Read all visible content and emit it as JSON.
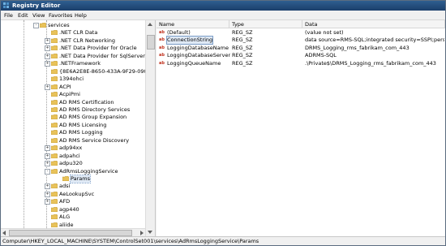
{
  "window": {
    "title": "Registry Editor"
  },
  "menubar": {
    "items": [
      "File",
      "Edit",
      "View",
      "Favorites",
      "Help"
    ]
  },
  "tree": {
    "items": [
      {
        "label": "services",
        "expander": "-"
      },
      {
        "label": ".NET CLR Data",
        "expander": ""
      },
      {
        "label": ".NET CLR Networking",
        "expander": "+"
      },
      {
        "label": ".NET Data Provider for Oracle",
        "expander": "+"
      },
      {
        "label": ".NET Data Provider for SqlServer",
        "expander": "+"
      },
      {
        "label": ".NETFramework",
        "expander": "+"
      },
      {
        "label": "{8E6A2E8E-8650-433A-9F29-09091",
        "expander": ""
      },
      {
        "label": "1394ohci",
        "expander": ""
      },
      {
        "label": "ACPI",
        "expander": "+"
      },
      {
        "label": "AcpiPmi",
        "expander": ""
      },
      {
        "label": "AD RMS Certification",
        "expander": ""
      },
      {
        "label": "AD RMS Directory Services",
        "expander": ""
      },
      {
        "label": "AD RMS Group Expansion",
        "expander": ""
      },
      {
        "label": "AD RMS Licensing",
        "expander": ""
      },
      {
        "label": "AD RMS Logging",
        "expander": ""
      },
      {
        "label": "AD RMS Service Discovery",
        "expander": ""
      },
      {
        "label": "adp94xx",
        "expander": "+"
      },
      {
        "label": "adpahci",
        "expander": "+"
      },
      {
        "label": "adpu320",
        "expander": "+"
      },
      {
        "label": "AdRmsLoggingService",
        "expander": "-"
      },
      {
        "label": "Params",
        "expander": ""
      },
      {
        "label": "adsi",
        "expander": "+"
      },
      {
        "label": "AeLookupSvc",
        "expander": "+"
      },
      {
        "label": "AFD",
        "expander": "+"
      },
      {
        "label": "agp440",
        "expander": ""
      },
      {
        "label": "ALG",
        "expander": ""
      },
      {
        "label": "aliide",
        "expander": ""
      },
      {
        "label": "amdide",
        "expander": ""
      }
    ]
  },
  "values": {
    "columns": [
      "Name",
      "Type",
      "Data"
    ],
    "rows": [
      {
        "name": "(Default)",
        "type": "REG_SZ",
        "data": "(value not set)"
      },
      {
        "name": "ConnectionString",
        "type": "REG_SZ",
        "data": "data source=RMS-SQL;integrated security=SSPI;persi..."
      },
      {
        "name": "LoggingDatabaseName",
        "type": "REG_SZ",
        "data": "DRMS_Logging_rms_fabrikam_com_443"
      },
      {
        "name": "LoggingDatabaseServer",
        "type": "REG_SZ",
        "data": "ADRMS-SQL"
      },
      {
        "name": "LoggingQueueName",
        "type": "REG_SZ",
        "data": ".\\Private$\\DRMS_Logging_rms_fabrikam_com_443"
      }
    ]
  },
  "statusbar": {
    "path": "Computer\\HKEY_LOCAL_MACHINE\\SYSTEM\\ControlSet001\\services\\AdRmsLoggingService\\Params"
  },
  "colors": {
    "titlebar": "#1b3f6b",
    "folder": "#e8c25a",
    "selection": "#dfe9f5",
    "value_icon": "#c0301c"
  }
}
